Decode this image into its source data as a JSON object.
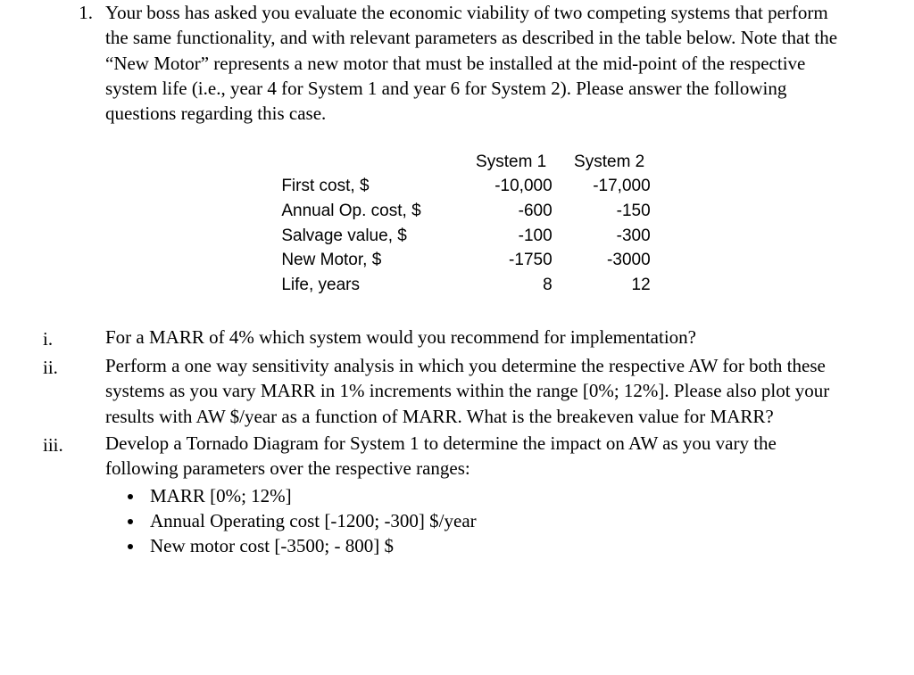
{
  "question": {
    "number": "1.",
    "intro": "Your boss has asked you evaluate the economic viability of two competing systems that perform the same functionality, and with relevant parameters as described in the table below.   Note that the “New Motor” represents a new motor that must be installed at the mid-point of the respective system life (i.e., year 4 for System 1 and year 6 for System 2).  Please answer the following questions regarding this case."
  },
  "table": {
    "headers": {
      "label": "",
      "col1": "System 1",
      "col2": "System 2"
    },
    "rows": [
      {
        "label": "First cost, $",
        "col1": "-10,000",
        "col2": "-17,000"
      },
      {
        "label": "Annual Op. cost, $",
        "col1": "-600",
        "col2": "-150"
      },
      {
        "label": "Salvage value, $",
        "col1": "-100",
        "col2": "-300"
      },
      {
        "label": "New Motor, $",
        "col1": "-1750",
        "col2": "-3000"
      },
      {
        "label": "Life, years",
        "col1": "8",
        "col2": "12"
      }
    ]
  },
  "subparts": {
    "i": {
      "num": "i.",
      "text": "For a MARR of 4% which system would you recommend for implementation?"
    },
    "ii": {
      "num": "ii.",
      "text": "Perform a one way sensitivity analysis in which you determine the respective AW for both these systems as you vary MARR in 1% increments within the range [0%; 12%].  Please also plot your results with AW $/year as a function of MARR.  What is the breakeven value for MARR?"
    },
    "iii": {
      "num": "iii.",
      "text": "Develop a Tornado Diagram for System 1 to determine the impact on AW as you vary the following parameters over the respective ranges:",
      "bullets": [
        "MARR [0%; 12%]",
        "Annual Operating cost [-1200; -300] $/year",
        "New motor cost [-3500; - 800] $"
      ]
    }
  }
}
